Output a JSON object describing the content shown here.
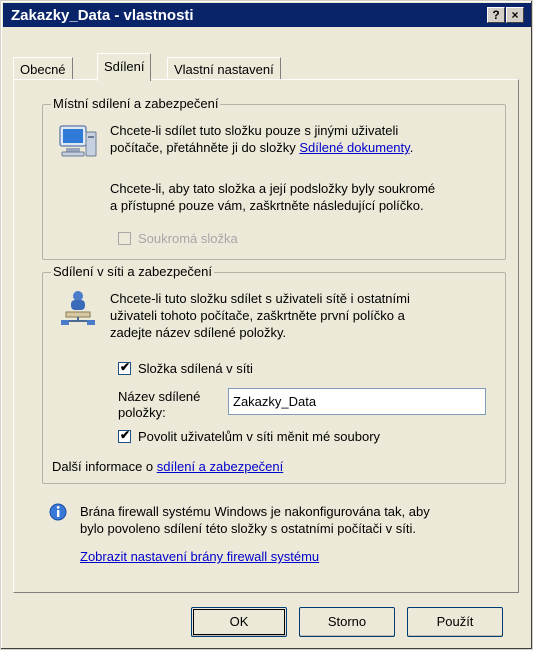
{
  "window": {
    "title": "Zakazky_Data - vlastnosti",
    "help_button": "?",
    "close_button": "×"
  },
  "tabs": [
    {
      "label": "Obecné",
      "active": false
    },
    {
      "label": "Sdílení",
      "active": true
    },
    {
      "label": "Vlastní nastavení",
      "active": false
    }
  ],
  "local_sharing": {
    "group_title": "Místní sdílení a zabezpečení",
    "icon": "computer-icon",
    "text1_line1": "Chcete-li sdílet tuto složku pouze s jinými uživateli",
    "text1_line2_prefix": "počítače, přetáhněte ji do složky ",
    "text1_link": "Sdílené dokumenty",
    "text1_suffix": ".",
    "text2_line1": "Chcete-li, aby tato složka a její podsložky byly soukromé",
    "text2_line2": "a přístupné pouze vám, zaškrtněte následující políčko.",
    "private_checkbox_label": "Soukromá složka",
    "private_checked": false,
    "private_enabled": false
  },
  "network_sharing": {
    "group_title": "Sdílení v síti a zabezpečení",
    "icon": "network-share-icon",
    "text_line1": "Chcete-li tuto složku sdílet s uživateli sítě i ostatními",
    "text_line2": "uživateli tohoto počítače, zaškrtněte první políčko a",
    "text_line3": "zadejte název sdílené položky.",
    "share_checkbox_label": "Složka sdílená v síti",
    "share_checked": true,
    "share_name_label_line1": "Název sdílené",
    "share_name_label_line2": "položky:",
    "share_name_value": "Zakazky_Data",
    "allow_change_label": "Povolit uživatelům v síti měnit mé soubory",
    "allow_change_checked": true,
    "more_info_prefix": "Další informace o ",
    "more_info_link": "sdílení a zabezpečení"
  },
  "firewall": {
    "icon": "info-icon",
    "text_line1": "Brána firewall systému Windows je nakonfigurována tak, aby",
    "text_line2": "bylo povoleno sdílení této složky s ostatními počítači v síti.",
    "link": "Zobrazit nastavení brány firewall systému"
  },
  "buttons": {
    "ok": "OK",
    "cancel": "Storno",
    "apply": "Použít"
  }
}
